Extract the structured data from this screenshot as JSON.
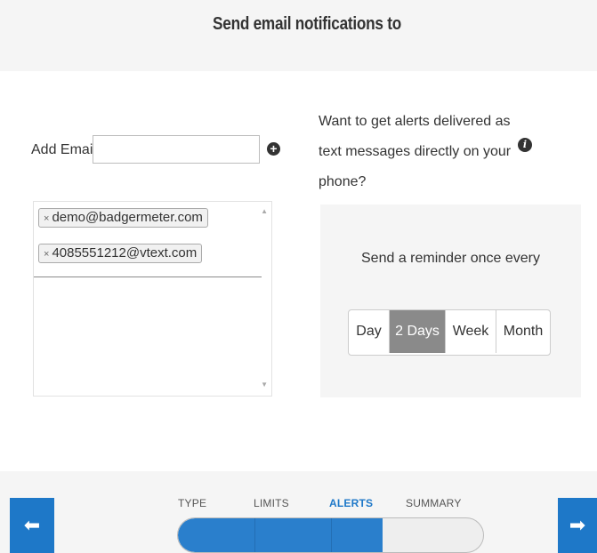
{
  "header": {
    "title": "Send email notifications to"
  },
  "add_email": {
    "label": "Add Email:",
    "value": "",
    "add_icon": "plus-circle-icon"
  },
  "alerts_prompt": {
    "text": "Want to get alerts delivered as text messages directly on your phone?",
    "info_icon": "info-icon"
  },
  "email_list": {
    "items": [
      {
        "remove": "×",
        "address": "demo@badgermeter.com"
      },
      {
        "remove": "×",
        "address": "4085551212@vtext.com"
      }
    ],
    "scroll_up": "▲",
    "scroll_down": "▼"
  },
  "reminder": {
    "label": "Send a reminder once every",
    "options": [
      "Day",
      "2 Days",
      "Week",
      "Month"
    ],
    "selected": "2 Days"
  },
  "wizard": {
    "steps": [
      "TYPE",
      "LIMITS",
      "ALERTS",
      "SUMMARY"
    ],
    "active_step": "ALERTS",
    "progress_fraction": 0.67,
    "prev_icon": "arrow-left-icon",
    "next_icon": "arrow-right-icon",
    "prev_glyph": "⬅",
    "next_glyph": "➡"
  },
  "colors": {
    "accent": "#1e78c8",
    "selected_segment": "#8a8a8a",
    "panel_bg": "#f5f5f5"
  }
}
